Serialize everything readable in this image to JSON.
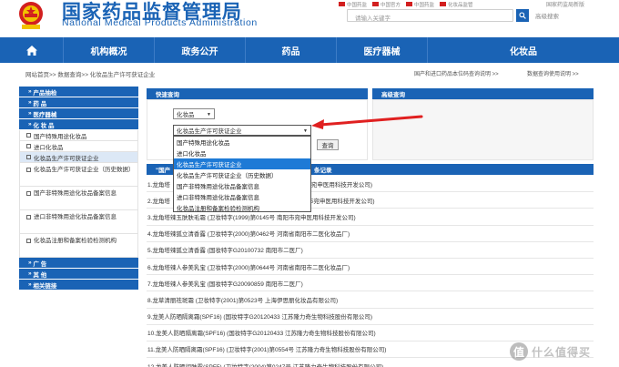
{
  "header": {
    "title_cn": "国家药品监督管理局",
    "title_en": "National Medical Products Administration",
    "top_links": [
      "中国药监",
      "中国官方",
      "中国药监",
      "化妆品监管"
    ],
    "top_right_link": "国家药监局新版",
    "search_placeholder": "请输入关键字",
    "advanced_search": "高级搜索"
  },
  "nav": {
    "home_icon": "home-icon",
    "items": [
      "机构概况",
      "政务公开",
      "药品",
      "医疗器械",
      "化妆品"
    ]
  },
  "breadcrumb": {
    "path": "网站首页>> 数据查询>> 化妆品生产许可获证企业",
    "right_link_1": "国产和进口药品本位码查询说明 >>",
    "right_link_2": "数据查询使用说明 >>"
  },
  "sidebar": {
    "sections": [
      "产品抽检",
      "药 品",
      "医疗器械",
      "化 妆 品"
    ],
    "subitems": [
      "国产特殊用途化妆品",
      "进口化妆品",
      "化妆品生产许可获证企业",
      "化妆品生产许可获证企业（历史数据）",
      "国产非特殊用途化妆品备案信息",
      "进口非特殊用途化妆品备案信息",
      "化妆品注册和备案检验检测机构"
    ],
    "bottom_sections": [
      "广 告",
      "其 他",
      "相关链接"
    ]
  },
  "search": {
    "quick_title": "快速查询",
    "advanced_title": "高级查询",
    "category_value": "化妆品",
    "subcategory_value": "化妆品生产许可获证企业",
    "query_button": "查询",
    "dropdown_options": [
      "国产特殊用途化妆品",
      "进口化妆品",
      "化妆品生产许可获证企业",
      "化妆品生产许可获证企业（历史数据）",
      "国产非特殊用途化妆品备案信息",
      "进口非特殊用途化妆品备案信息",
      "化妆品注册和备案检验检测机构"
    ],
    "selected_index": 2
  },
  "results": {
    "header_left": "\"国产",
    "header_right": "条记录",
    "rows": [
      "1.龙角塔",
      "2.龙角塔",
      "3.龙角塔辣玉肤肤毛霜 (卫妆特字(1999)第0145号 南阳市宛申医用科技开发公司)",
      "4.龙角塔辣狐立清香露 (卫妆特字(2000)第0462号 河南省南阳市二医化妆品厂)",
      "5.龙角塔辣狐立清香露 (国妆特字G20100732 南阳市二医厂)",
      "6.龙角塔辣人参美乳宝 (卫妆特字(2000)第0644号 河南省南阳市二医化妆品厂)",
      "7.龙角塔辣人参美乳宝 (国妆特字G20090859 南阳市二医厂)",
      "8.龙草清丽祛斑霜 (卫妆特字(2001)第0523号 上海伊思丽化妆品有限公司)",
      "9.龙美人防晒隔离霜(SPF16) (国妆特字G20120433 江苏隆力奇生物科技股份有限公司)",
      "10.龙美人防晒隔离霜(SPF16) (国妆特字G20120433 江苏隆力奇生物科技股份有限公司)",
      "11.龙美人防晒隔离霜(SPF16) (卫妆特字(2001)第0554号 江苏隆力奇生物科技股份有限公司)",
      "12.龙美人防晒润肤露(SPF5) (卫妆特字(2004)第0247号 江苏隆力奇生物科技股份有限公司)"
    ],
    "row2_suffix": "南阳市宛申医用科技开发公司)",
    "row1_suffix": "阳市宛申医用科技开发公司)"
  },
  "watermark": {
    "badge": "值",
    "text": "什么值得买"
  },
  "colors": {
    "primary": "#1a63b5",
    "selected": "#1e7ad6",
    "arrow": "#e02020",
    "emblem": "#d21f1f"
  }
}
